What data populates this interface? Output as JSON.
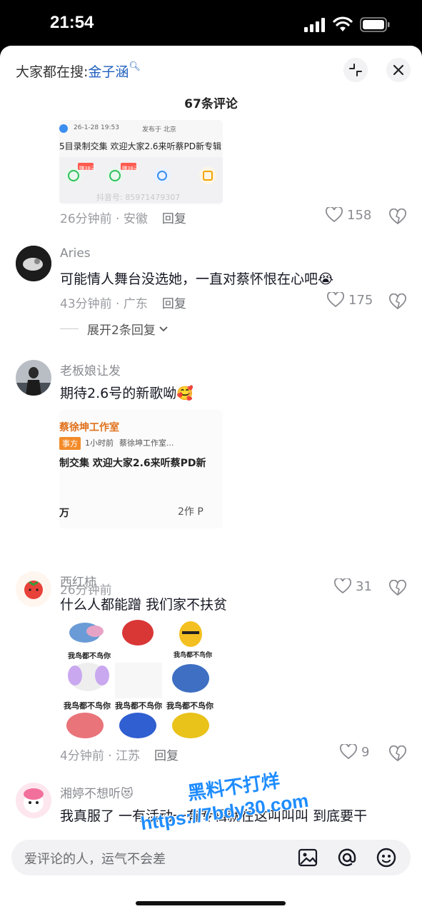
{
  "status": {
    "time": "21:54"
  },
  "search": {
    "prefix": "大家都在搜:",
    "keyword": "金子涵",
    "icon": "search-icon"
  },
  "comments_count": "67条评论",
  "comments": [
    {
      "card_date": "26-1-28 19:53",
      "card_location": "发布于 北京",
      "card_text": "5目录制交集 欢迎大家2.6来听蔡PD新专辑",
      "card_badge": "赚38元",
      "card_badge2": "赚38元",
      "card_id": "抖音号: 85971479307",
      "meta": "26分钟前 · 安徽",
      "reply": "回复",
      "likes": "158"
    },
    {
      "user": "Aries",
      "text": "可能情人舞台没选她，一直对蔡怀恨在心吧",
      "emoji": "😭",
      "meta": "43分钟前 · 广东",
      "reply": "回复",
      "likes": "175",
      "expand": "展开2条回复"
    },
    {
      "user": "老板娘让发",
      "text": "期待2.6号的新歌呦",
      "emoji": "🥰",
      "card_name": "蔡徐坤工作室",
      "card_role": "事方",
      "card_time": "1小时前",
      "card_author": "蔡徐坤工作室...",
      "card_text": "制交集 欢迎大家2.6来听蔡PD新",
      "card_count": "万",
      "card_like": "2作 P",
      "meta": "26分钟前",
      "likes": "31"
    },
    {
      "user": "西红柿",
      "text": "什么人都能蹭 我们家不扶贫",
      "sticker_top": "我鸟都不鸟你",
      "sticker_mid1": "我鸟都不鸟你",
      "sticker_bottom": [
        "我鸟都不鸟你",
        "我鸟都不鸟你",
        "我鸟都不鸟你"
      ],
      "meta": "4分钟前 · 江苏",
      "reply": "回复",
      "likes": "9"
    },
    {
      "user": "湘婷不想听",
      "emoji": "😻",
      "text": "我真服了 一有活动一有专辑就在这叫叫叫 到底要干"
    }
  ],
  "input": {
    "placeholder": "爱评论的人，运气不会差"
  },
  "watermark": {
    "line1": "黑料不打烊",
    "line2": "https://7bdy30.com"
  },
  "colors": {
    "link": "#1f5fbf",
    "watermark": "#1e8cff",
    "text": "#161823",
    "meta": "#9a9ba1"
  }
}
